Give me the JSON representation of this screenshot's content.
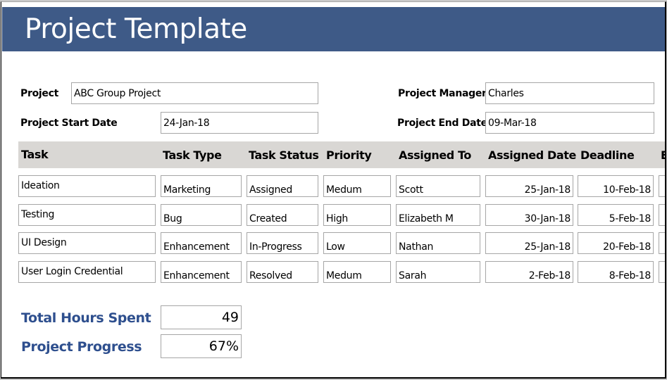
{
  "title": "Project Template",
  "colors": {
    "banner": "#3e5a87",
    "header_band": "#d9d7d4",
    "summary_label": "#2e4f8e",
    "field_border": "#a6a6a6"
  },
  "project_info": {
    "project_label": "Project",
    "project_value": "ABC Group Project",
    "manager_label": "Project Manager",
    "manager_value": "Charles",
    "start_label": "Project Start Date",
    "start_value": "24-Jan-18",
    "end_label": "Project End Date",
    "end_value": "09-Mar-18"
  },
  "table": {
    "columns": [
      "Task",
      "Task Type",
      "Task Status",
      "Priority",
      "Assigned To",
      "Assigned Date",
      "Deadline",
      "E"
    ],
    "rows": [
      {
        "task": "Ideation",
        "type": "Marketing",
        "status": "Assigned",
        "priority": "Medum",
        "assigned_to": "Scott",
        "assigned_date": "25-Jan-18",
        "deadline": "10-Feb-18"
      },
      {
        "task": "Testing",
        "type": "Bug",
        "status": "Created",
        "priority": "High",
        "assigned_to": "Elizabeth M",
        "assigned_date": "30-Jan-18",
        "deadline": "5-Feb-18"
      },
      {
        "task": "UI Design",
        "type": "Enhancement",
        "status": "In-Progress",
        "priority": "Low",
        "assigned_to": "Nathan",
        "assigned_date": "25-Jan-18",
        "deadline": "20-Feb-18"
      },
      {
        "task": "User Login Credential",
        "type": "Enhancement",
        "status": "Resolved",
        "priority": "Medum",
        "assigned_to": "Sarah",
        "assigned_date": "2-Feb-18",
        "deadline": "8-Feb-18"
      }
    ]
  },
  "summary": {
    "hours_label": "Total Hours Spent",
    "hours_value": "49",
    "progress_label": "Project Progress",
    "progress_value": "67%"
  }
}
